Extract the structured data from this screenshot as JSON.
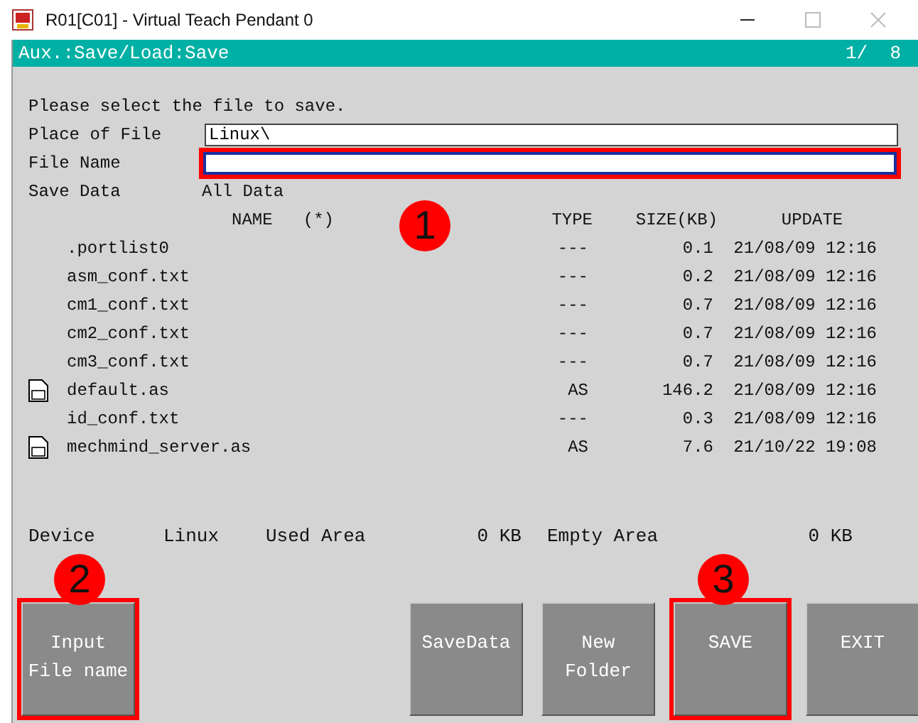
{
  "window": {
    "title": "R01[C01] - Virtual Teach Pendant 0"
  },
  "header": {
    "title": "Aux.:Save/Load:Save",
    "page": "1/  8"
  },
  "prompt": "Please select the file to save.",
  "fields": [
    {
      "label": "Place of File",
      "value": "Linux\\",
      "highlighted": false
    },
    {
      "label": "File Name",
      "highlighted": true
    }
  ],
  "save_data": {
    "label": "Save Data",
    "value": "All Data"
  },
  "table": {
    "columns": [
      "NAME   (*)",
      "TYPE",
      "SIZE(KB)",
      "UPDATE"
    ],
    "rows": [
      {
        "name": ".portlist0",
        "type": "---",
        "size": "0.1",
        "update": "21/08/09 12:16",
        "kind": "plain"
      },
      {
        "name": "asm_conf.txt",
        "type": "---",
        "size": "0.2",
        "update": "21/08/09 12:16",
        "kind": "plain"
      },
      {
        "name": "cm1_conf.txt",
        "type": "---",
        "size": "0.7",
        "update": "21/08/09 12:16",
        "kind": "plain"
      },
      {
        "name": "cm2_conf.txt",
        "type": "---",
        "size": "0.7",
        "update": "21/08/09 12:16",
        "kind": "plain"
      },
      {
        "name": "cm3_conf.txt",
        "type": "---",
        "size": "0.7",
        "update": "21/08/09 12:16",
        "kind": "plain"
      },
      {
        "name": "default.as",
        "type": "AS",
        "size": "146.2",
        "update": "21/08/09 12:16",
        "kind": "as"
      },
      {
        "name": "id_conf.txt",
        "type": "---",
        "size": "0.3",
        "update": "21/08/09 12:16",
        "kind": "plain"
      },
      {
        "name": "mechmind_server.as",
        "type": "AS",
        "size": "7.6",
        "update": "21/10/22 19:08",
        "kind": "as"
      }
    ]
  },
  "status": {
    "device_label": "Device",
    "device": "Linux",
    "used_label": "Used Area",
    "used": "0 KB",
    "empty_label": "Empty Area",
    "empty": "0 KB"
  },
  "buttons": [
    {
      "label": "Input\nFile name",
      "highlighted": true
    },
    {
      "label": "SaveData",
      "highlighted": false
    },
    {
      "label": "New\nFolder",
      "highlighted": false
    },
    {
      "label": "SAVE",
      "highlighted": true
    },
    {
      "label": "EXIT",
      "highlighted": false
    }
  ],
  "markers": [
    "1",
    "2",
    "3"
  ]
}
